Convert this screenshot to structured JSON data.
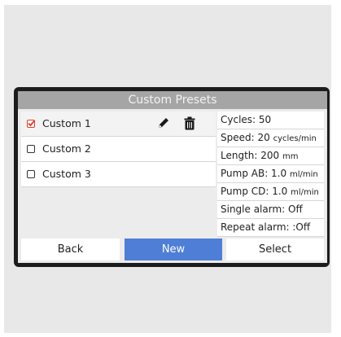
{
  "header": {
    "title": "Custom Presets"
  },
  "presets": [
    {
      "label": "Custom 1",
      "checked": true
    },
    {
      "label": "Custom 2",
      "checked": false
    },
    {
      "label": "Custom 3",
      "checked": false
    }
  ],
  "details": {
    "cycles": "Cycles: 50",
    "speed": "Speed: 20",
    "speed_unit": "cycles/min",
    "length": "Length: 200",
    "length_unit": "mm",
    "pump_ab": "Pump AB: 1.0",
    "pump_ab_unit": "ml/min",
    "pump_cd": "Pump CD: 1.0",
    "pump_cd_unit": "ml/min",
    "single_alarm": "Single alarm: Off",
    "repeat_alarm": "Repeat alarm: :Off"
  },
  "buttons": {
    "back": "Back",
    "new": "New",
    "select": "Select"
  },
  "icons": {
    "edit": "pencil-icon",
    "delete": "trash-icon",
    "checked": "checkbox-checked-icon"
  },
  "colors": {
    "accent": "#4e7ed6",
    "check": "#e23a2a",
    "title_bar": "#a5a5a5",
    "bezel": "#1c1c1c"
  }
}
